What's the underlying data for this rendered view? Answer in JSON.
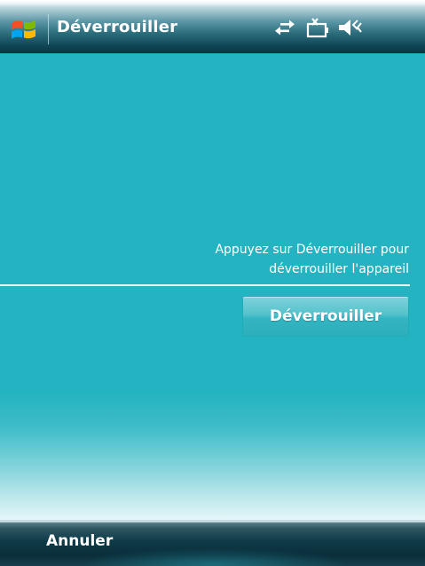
{
  "titlebar": {
    "title": "Déverrouiller",
    "start_icon": "windows-flag-icon",
    "status_icons": [
      "connectivity-arrows-icon",
      "battery-missing-icon",
      "speaker-volume-icon"
    ]
  },
  "content": {
    "message_line1": "Appuyez sur Déverrouiller pour",
    "message_line2": "déverrouiller l'appareil",
    "unlock_button_label": "Déverrouiller"
  },
  "softkeys": {
    "left_label": "Annuler"
  },
  "colors": {
    "content_background": "#24b3c1",
    "text": "#ffffff",
    "bar_dark": "#0e3a47"
  }
}
